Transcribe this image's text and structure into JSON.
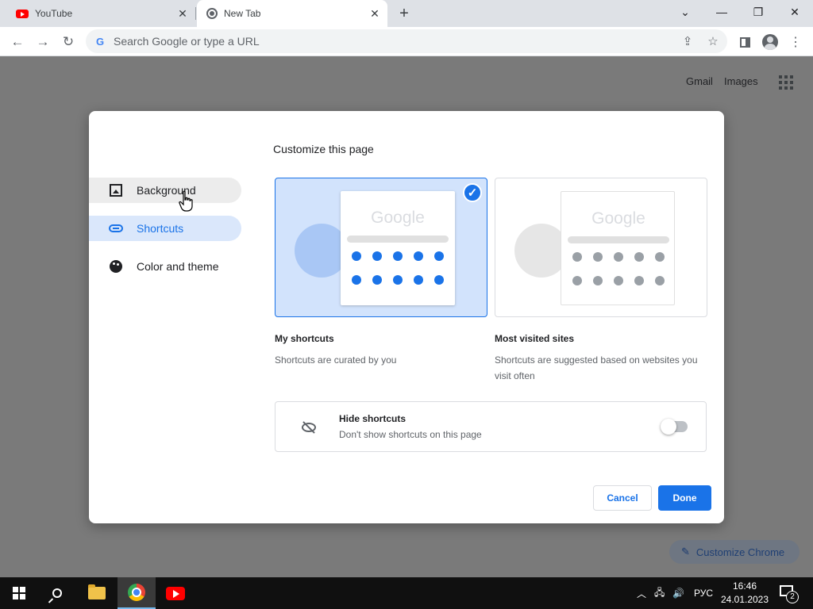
{
  "browser": {
    "tabs": [
      {
        "title": "YouTube",
        "icon": "youtube-icon",
        "active": false
      },
      {
        "title": "New Tab",
        "icon": "chrome-icon",
        "active": true
      }
    ],
    "new_tab_glyph": "+",
    "close_glyph": "✕",
    "window_controls": {
      "tab_search": "⌄",
      "minimize": "—",
      "restore": "❐",
      "close": "✕"
    },
    "nav": {
      "back": "←",
      "forward": "→",
      "reload": "↻"
    },
    "omnibox": {
      "placeholder": "Search Google or type a URL",
      "value": "",
      "g_glyph": "G"
    },
    "toolbar_icons": {
      "share": "⇪",
      "bookmark": "☆",
      "menu": "⋮"
    }
  },
  "ntp": {
    "gmail": "Gmail",
    "images": "Images",
    "customize_chrome": "Customize Chrome",
    "pencil_glyph": "✎"
  },
  "dialog": {
    "title": "Customize this page",
    "sidebar": [
      {
        "label": "Background",
        "icon": "image-icon",
        "state": "hover"
      },
      {
        "label": "Shortcuts",
        "icon": "link-icon",
        "state": "selected"
      },
      {
        "label": "Color and theme",
        "icon": "palette-icon",
        "state": "normal"
      }
    ],
    "options": [
      {
        "label": "My shortcuts",
        "description": "Shortcuts are curated by you",
        "selected": true,
        "logo": "Google"
      },
      {
        "label": "Most visited sites",
        "description": "Shortcuts are suggested based on websites you visit often",
        "selected": false,
        "logo": "Google"
      }
    ],
    "check_glyph": "✓",
    "hide_shortcuts": {
      "title": "Hide shortcuts",
      "subtitle": "Don't show shortcuts on this page",
      "enabled": false
    },
    "buttons": {
      "cancel": "Cancel",
      "done": "Done"
    }
  },
  "taskbar": {
    "apps": [
      "start-icon",
      "search-icon",
      "file-explorer-icon",
      "chrome-icon",
      "youtube-icon"
    ],
    "tray": {
      "chevron": "︿",
      "network": "🖧",
      "volume": "🔊",
      "language": "РУС"
    },
    "time": "16:46",
    "date": "24.01.2023",
    "notifications": "2"
  },
  "colors": {
    "accent": "#1a73e8",
    "selected_bg": "#dae7fb",
    "overlay": "#7a7a7a",
    "taskbar": "#101010"
  }
}
